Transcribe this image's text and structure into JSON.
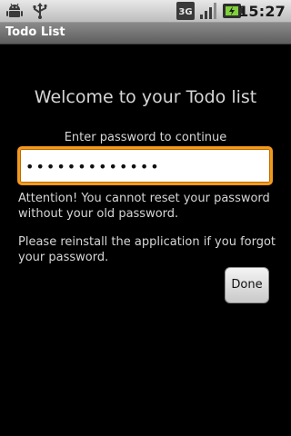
{
  "status_bar": {
    "time": "15:27",
    "network_label": "3G",
    "icons": [
      "android-debug-icon",
      "usb-icon",
      "network-3g-icon",
      "signal-strength-icon",
      "battery-charging-icon"
    ]
  },
  "app": {
    "title": "Todo List"
  },
  "main": {
    "welcome": "Welcome to your Todo list",
    "prompt": "Enter password to continue",
    "password_value": "•••••••••••••",
    "attention_text": "Attention! You cannot reset your password without your old password.",
    "reinstall_text": "Please reinstall the application if you forgot your password.",
    "done_label": "Done"
  },
  "colors": {
    "background": "#000000",
    "text": "#d6d6d6",
    "focus_border": "#f39a1c",
    "title_bar": "#6e6e6e",
    "status_bar": "#d4d4d4"
  }
}
